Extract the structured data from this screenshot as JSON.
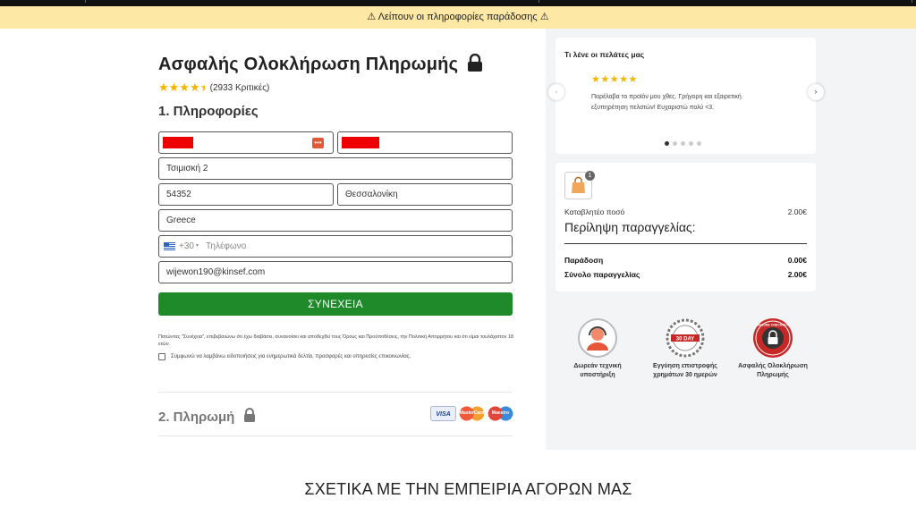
{
  "banner": {
    "text": "Λείπουν οι πληροφορίες παράδοσης"
  },
  "header": {
    "title": "Ασφαλής Ολοκλήρωση Πληρωμής",
    "reviews": "(2933 Κριτικές)",
    "rating": 4.5
  },
  "info_section": {
    "title": "1. Πληροφορίες"
  },
  "form": {
    "address": "Τσιμισκή 2",
    "postcode": "54352",
    "city": "Θεσσαλονίκη",
    "country": "Greece",
    "phone_prefix": "+30",
    "phone_placeholder": "Τηλέφωνο",
    "email": "wijewon190@kinsef.com"
  },
  "cta": {
    "label": "ΣΥΝΕΧΕΙΑ"
  },
  "legal": {
    "text": "Πατώντας \"Συνέχεια\", επιβεβαιώνω ότι έχω διαβάσει, συνανοίσει και αποδεχθεί τους Όρους και Προϋποθέσεις, την Πολιτική Απορρήτου και ότι είμαι τουλάχιστον 18 ετών."
  },
  "newsletter": {
    "label": "Συμφωνώ να λαμβάνω ειδοποιήσεις για ενημερωτικά δελτία, προσφορές και υπηρεσίες επικοινωνίας."
  },
  "payment_section": {
    "title": "2. Πληρωμή",
    "cards": [
      "VISA",
      "MasterCard",
      "Maestro"
    ]
  },
  "testimonials": {
    "title": "Τι λένε οι πελάτες μας",
    "stars": "★★★★★",
    "text": "Παρέλαβα το προϊόν μου χθες. Γρήγορη και εξαιρετική εξυπηρέτηση πελατών! Ευχαριστώ πολύ <3.",
    "prev": "‹",
    "next": "›",
    "dot_count": 5
  },
  "order_summary": {
    "item_count": "1",
    "payable_label": "Καταβλητέο ποσό",
    "payable_value": "2.00€",
    "heading": "Περίληψη παραγγελίας:",
    "delivery_label": "Παράδοση",
    "delivery_value": "0.00€",
    "total_label": "Σύνολο παραγγελίας",
    "total_value": "2.00€"
  },
  "trust_badges": [
    {
      "icon": "support-agent-icon",
      "label": "Δωρεάν τεχνική υποστήριξη"
    },
    {
      "icon": "money-back-30-day-icon",
      "badge_text": "30 DAY",
      "label": "Εγγύηση επιστροφής χρημάτων 30 ημερών"
    },
    {
      "icon": "secure-checkout-icon",
      "badge_text": "SECURE CHECKOUT",
      "label": "Ασφαλής Ολοκλήρωση Πληρωμής"
    }
  ],
  "footer_section": {
    "title": "ΣΧΕΤΙΚΑ ΜΕ ΤΗΝ ΕΜΠΕΙΡΙΑ ΑΓΟΡΩΝ ΜΑΣ"
  },
  "colors": {
    "accent_green": "#1e8a2a",
    "banner_yellow": "#fde8a6",
    "star_gold": "#f5b400",
    "masked_red": "#e00000"
  }
}
